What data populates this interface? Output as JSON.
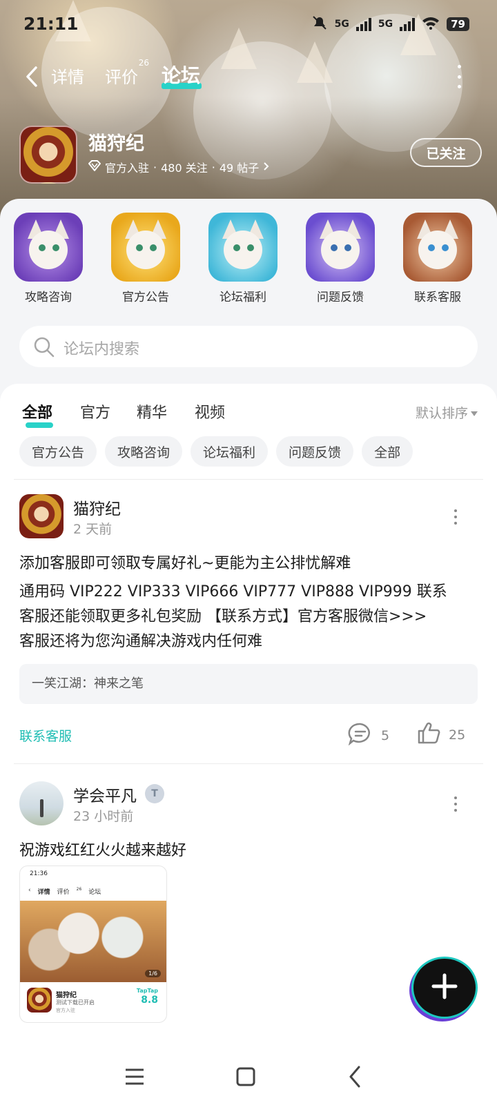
{
  "status_bar": {
    "time": "21:11",
    "network1": "5G",
    "network2": "5G",
    "battery": "79"
  },
  "nav": {
    "tabs": [
      {
        "label": "详情"
      },
      {
        "label": "评价",
        "badge": "26"
      },
      {
        "label": "论坛",
        "active": true
      }
    ]
  },
  "app": {
    "name": "猫狩纪",
    "official_label": "官方入驻",
    "follow_stats": "480 关注",
    "post_stats": "49 帖子",
    "separator": "·",
    "follow_button": "已关注"
  },
  "shortcuts": [
    {
      "label": "攻略咨询",
      "color": "#8a5cd0"
    },
    {
      "label": "官方公告",
      "color": "#f2c23a"
    },
    {
      "label": "论坛福利",
      "color": "#5ec8e0"
    },
    {
      "label": "问题反馈",
      "color": "#7b62d8"
    },
    {
      "label": "联系客服",
      "color": "#c9714a"
    }
  ],
  "search": {
    "placeholder": "论坛内搜索"
  },
  "feed_tabs": [
    {
      "label": "全部",
      "active": true
    },
    {
      "label": "官方"
    },
    {
      "label": "精华"
    },
    {
      "label": "视频"
    }
  ],
  "sort_label": "默认排序",
  "chips": [
    "官方公告",
    "攻略咨询",
    "论坛福利",
    "问题反馈",
    "全部"
  ],
  "posts": [
    {
      "author": "猫狩纪",
      "time": "2 天前",
      "title": "添加客服即可领取专属好礼~更能为主公排忧解难",
      "body_lines": [
        "通用码 VIP222 VIP333 VIP666 VIP777 VIP888 VIP999 联系",
        "客服还能领取更多礼包奖励 【联系方式】官方客服微信>>>",
        "客服还将为您沟通解决游戏内任何难"
      ],
      "quote": "一笑江湖：神来之笔",
      "link": "联系客服",
      "comments": "5",
      "likes": "25"
    },
    {
      "author": "学会平凡",
      "time": "23 小时前",
      "title": "祝游戏红红火火越来越好",
      "screenshot": {
        "time": "21:36",
        "tabs": [
          "详情",
          "评价",
          "论坛"
        ],
        "tab_badge": "26",
        "pager": "1/6",
        "app_name": "猫狩纪",
        "subtitle": "测试下载已开启",
        "official": "官方入驻",
        "brand": "TapTap",
        "score": "8.8"
      }
    }
  ],
  "colors": {
    "accent": "#29d2c8",
    "link": "#1fbdb3"
  }
}
